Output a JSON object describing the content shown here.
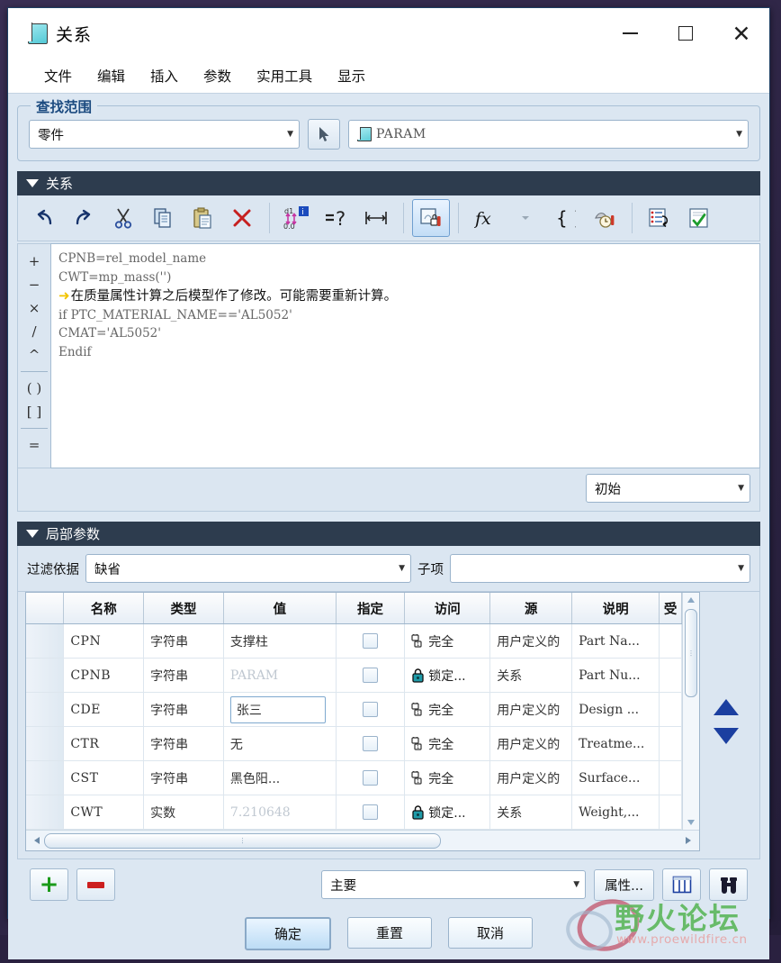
{
  "window": {
    "title": "关系",
    "icon": "param-model-icon",
    "buttons": {
      "minimize": "–",
      "maximize": "□",
      "close": "✕"
    }
  },
  "menubar": {
    "items": [
      {
        "label": "文件",
        "name": "menu-file"
      },
      {
        "label": "编辑",
        "name": "menu-edit"
      },
      {
        "label": "插入",
        "name": "menu-insert"
      },
      {
        "label": "参数",
        "name": "menu-parameters"
      },
      {
        "label": "实用工具",
        "name": "menu-utilities"
      },
      {
        "label": "显示",
        "name": "menu-display"
      }
    ]
  },
  "lookin": {
    "group_title": "查找范围",
    "scope_value": "零件",
    "picker_icon": "cursor-arrow-icon",
    "model_value": "PARAM"
  },
  "relations": {
    "section_title": "关系",
    "toolbar": [
      {
        "name": "undo-button",
        "icon": "undo-icon"
      },
      {
        "name": "redo-button",
        "icon": "redo-icon"
      },
      {
        "name": "cut-button",
        "icon": "scissors-icon"
      },
      {
        "name": "copy-button",
        "icon": "copy-icon"
      },
      {
        "name": "paste-button",
        "icon": "clipboard-icon"
      },
      {
        "name": "delete-button",
        "icon": "red-x-icon"
      },
      {
        "name": "switch-dimensions-button",
        "icon": "dimension-toggle-icon"
      },
      {
        "name": "evaluate-button",
        "icon": "equals-question-icon"
      },
      {
        "name": "dimension-span-button",
        "icon": "span-arrow-icon"
      },
      {
        "name": "units-lock-button",
        "icon": "locked-units-icon"
      },
      {
        "name": "function-button",
        "icon": "fx-icon"
      },
      {
        "name": "brackets-button",
        "icon": "curly-brackets-icon"
      },
      {
        "name": "units-convert-button",
        "icon": "units-tool-icon"
      },
      {
        "name": "insert-from-list-button",
        "icon": "list-arrow-icon"
      },
      {
        "name": "verify-button",
        "icon": "checkmark-document-icon"
      }
    ],
    "operators": [
      "+",
      "−",
      "×",
      "/",
      "^",
      "( )",
      "[ ]",
      "="
    ],
    "code_lines": [
      {
        "text": "CPNB=rel_model_name",
        "style": "code"
      },
      {
        "text": "CWT=mp_mass('')",
        "style": "code"
      },
      {
        "text": "在质量属性计算之后模型作了修改。可能需要重新计算。",
        "style": "warning"
      },
      {
        "text": "if PTC_MATERIAL_NAME=='AL5052'",
        "style": "code"
      },
      {
        "text": "CMAT='AL5052'",
        "style": "code"
      },
      {
        "text": "Endif",
        "style": "code"
      }
    ],
    "state_value": "初始"
  },
  "local_params": {
    "section_title": "局部参数",
    "filter_label": "过滤依据",
    "filter_value": "缺省",
    "child_label": "子项",
    "child_value": "",
    "columns": [
      "名称",
      "类型",
      "值",
      "指定",
      "访问",
      "源",
      "说明",
      "受"
    ],
    "rows": [
      {
        "name": "CPN",
        "type": "字符串",
        "value": "支撑柱",
        "value_edit": false,
        "designate": false,
        "access": "完全",
        "access_icon": "unlocked-icon",
        "source": "用户定义的",
        "description": "Part Na..."
      },
      {
        "name": "CPNB",
        "type": "字符串",
        "value": "PARAM",
        "value_edit": false,
        "value_dim": true,
        "designate": false,
        "access": "锁定...",
        "access_icon": "locked-icon",
        "source": "关系",
        "description": "Part Nu..."
      },
      {
        "name": "CDE",
        "type": "字符串",
        "value": "张三",
        "value_edit": true,
        "designate": false,
        "access": "完全",
        "access_icon": "unlocked-icon",
        "source": "用户定义的",
        "description": "Design ..."
      },
      {
        "name": "CTR",
        "type": "字符串",
        "value": "无",
        "value_edit": false,
        "designate": false,
        "access": "完全",
        "access_icon": "unlocked-icon",
        "source": "用户定义的",
        "description": "Treatme..."
      },
      {
        "name": "CST",
        "type": "字符串",
        "value": "黑色阳...",
        "value_edit": false,
        "designate": false,
        "access": "完全",
        "access_icon": "unlocked-icon",
        "source": "用户定义的",
        "description": "Surface..."
      },
      {
        "name": "CWT",
        "type": "实数",
        "value": "7.210648",
        "value_edit": false,
        "value_dim": true,
        "designate": false,
        "access": "锁定...",
        "access_icon": "locked-icon",
        "source": "关系",
        "description": "Weight,..."
      }
    ],
    "actions": {
      "add_label": "+",
      "remove_label": "−",
      "view_value": "主要",
      "properties_label": "属性...",
      "columns_icon": "table-columns-icon",
      "find_icon": "binoculars-icon"
    }
  },
  "dialog_buttons": {
    "ok": "确定",
    "reset": "重置",
    "cancel": "取消"
  },
  "watermark": {
    "text_cn": "野火论坛",
    "url": "www.proewildfire.cn"
  }
}
